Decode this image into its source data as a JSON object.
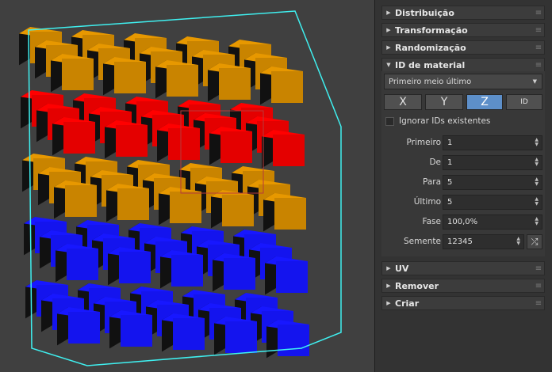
{
  "colors": {
    "gold": "#c98400",
    "red": "#e40000",
    "blue": "#1414ee",
    "selection": "#3ff0f0",
    "accent": "#5d8fc9"
  },
  "rollouts": {
    "distribution": "Distribuição",
    "transform": "Transformação",
    "randomize": "Randomização",
    "material_id": "ID de material",
    "uv": "UV",
    "remove": "Remover",
    "create": "Criar"
  },
  "material": {
    "mode": "Primeiro meio último",
    "axes": [
      "X",
      "Y",
      "Z",
      "ID"
    ],
    "active_axis": "Z",
    "ignore_existing": "Ignorar IDs existentes",
    "ignore_existing_checked": false,
    "fields": [
      {
        "label": "Primeiro",
        "value": "1"
      },
      {
        "label": "De",
        "value": "1"
      },
      {
        "label": "Para",
        "value": "5"
      },
      {
        "label": "Último",
        "value": "5"
      },
      {
        "label": "Fase",
        "value": "100,0%"
      },
      {
        "label": "Semente",
        "value": "12345"
      }
    ]
  },
  "icons": {
    "expand": "triangle-right-icon",
    "collapse": "triangle-down-icon",
    "grip": "grip-lines-icon",
    "spin": "up-down-arrows-icon",
    "shuffle": "shuffle-icon"
  },
  "viewport": {
    "grid_size": 5,
    "layer_colors_bottom_to_top": [
      "blue",
      "blue",
      "gold",
      "red",
      "gold"
    ]
  }
}
